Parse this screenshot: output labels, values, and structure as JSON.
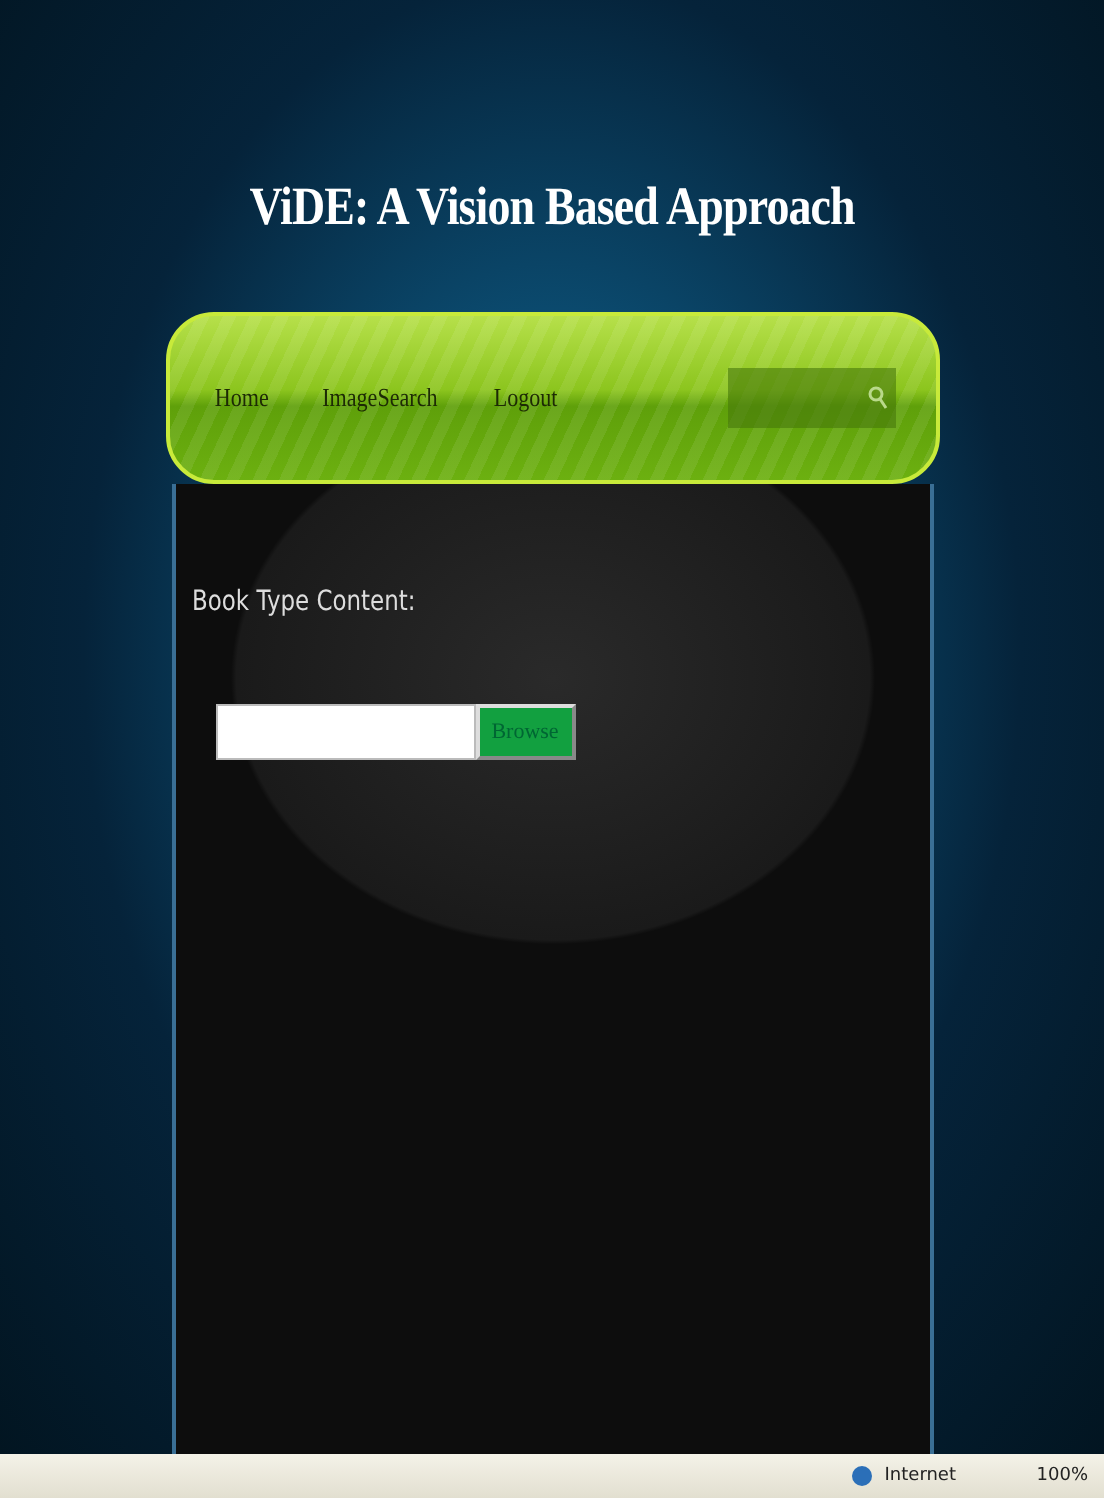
{
  "title": "ViDE: A Vision Based Approach",
  "nav": {
    "items": [
      {
        "label": "Home"
      },
      {
        "label": "ImageSearch"
      },
      {
        "label": "Logout"
      }
    ]
  },
  "form": {
    "label": "Book Type Content:",
    "button": "Browse"
  },
  "status_bar": {
    "zone": "Internet",
    "zoom": "100%"
  }
}
